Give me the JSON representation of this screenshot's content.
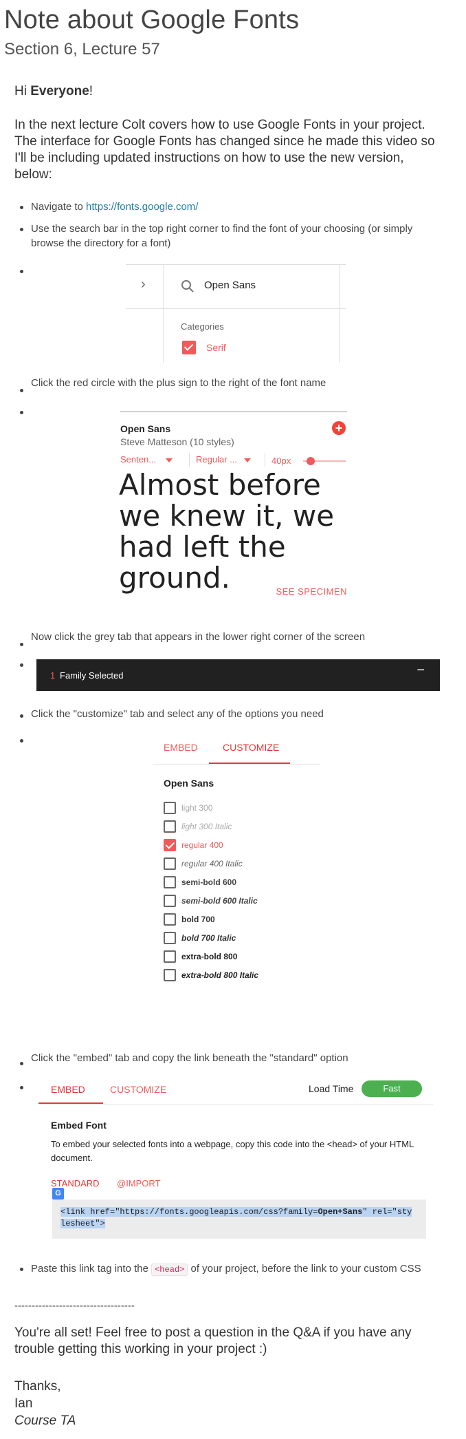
{
  "page": {
    "title": "Note about Google Fonts",
    "subtitle": "Section 6, Lecture 57",
    "greeting_prefix": "Hi ",
    "greeting_bold": "Everyone",
    "greeting_suffix": "!",
    "intro": "In the next lecture Colt covers how to use Google Fonts in your project. The interface for Google Fonts has changed since he made this video so I'll be including updated instructions on how to use the new version, below:"
  },
  "steps": {
    "s1_prefix": "Navigate to ",
    "s1_link": "https://fonts.google.com/",
    "s2": "Use the search bar in the top right corner to find the font of your choosing (or simply browse the directory for a font)",
    "s3": "Click the red circle with the plus sign to the right of the font name",
    "s4": "Now click the grey tab that appears in the lower right corner of the screen",
    "s5": "Click the \"customize\" tab and select any of the options you need",
    "s6": "Click the \"embed\" tab and copy the link beneath the \"standard\" option",
    "s7_prefix": "Paste this link tag into the ",
    "s7_code": "<head>",
    "s7_suffix": " of your project, before the link to your custom CSS"
  },
  "search_shot": {
    "query": "Open Sans",
    "categories_label": "Categories",
    "category": "Serif"
  },
  "font_card": {
    "name": "Open Sans",
    "designer": "Steve Matteson (10 styles)",
    "sentence_select": "Senten...",
    "style_select": "Regular ...",
    "size": "40px",
    "sample": "Almost before we knew it, we had left the ground.",
    "specimen": "SEE SPECIMEN"
  },
  "tray": {
    "count": "1",
    "label": "Family Selected",
    "minimize": "−"
  },
  "customize_shot": {
    "tab_embed": "EMBED",
    "tab_customize": "CUSTOMIZE",
    "family": "Open Sans",
    "options": [
      {
        "label": "light 300",
        "checked": false
      },
      {
        "label": "light 300 Italic",
        "checked": false
      },
      {
        "label": "regular 400",
        "checked": true
      },
      {
        "label": "regular 400 Italic",
        "checked": false
      },
      {
        "label": "semi-bold 600",
        "checked": false
      },
      {
        "label": "semi-bold 600 Italic",
        "checked": false
      },
      {
        "label": "bold 700",
        "checked": false
      },
      {
        "label": "bold 700 Italic",
        "checked": false
      },
      {
        "label": "extra-bold 800",
        "checked": false
      },
      {
        "label": "extra-bold 800 Italic",
        "checked": false
      }
    ]
  },
  "embed_shot": {
    "tab_embed": "EMBED",
    "tab_customize": "CUSTOMIZE",
    "load_time_label": "Load Time",
    "load_time_value": "Fast",
    "heading": "Embed Font",
    "desc": "To embed your selected fonts into a webpage, copy this code into the <head> of your HTML document.",
    "standard": "STANDARD",
    "import": "@IMPORT",
    "code_a": "<link href=\"https://fonts.googleapis.com/css?family=",
    "code_b": "Open+Sans",
    "code_c": "\" rel=\"sty",
    "code_d": "lesheet\">"
  },
  "footer": {
    "divider": "-----------------------------------",
    "closing": "You're all set! Feel free to post a question in the Q&A if you have any trouble getting this working in your project :)",
    "thanks": "Thanks,",
    "name": "Ian",
    "role": "Course TA"
  },
  "colors": {
    "accent": "#f15a5a",
    "link": "#1f7fa0",
    "green": "#4caf50",
    "dark_tray": "#212121"
  }
}
